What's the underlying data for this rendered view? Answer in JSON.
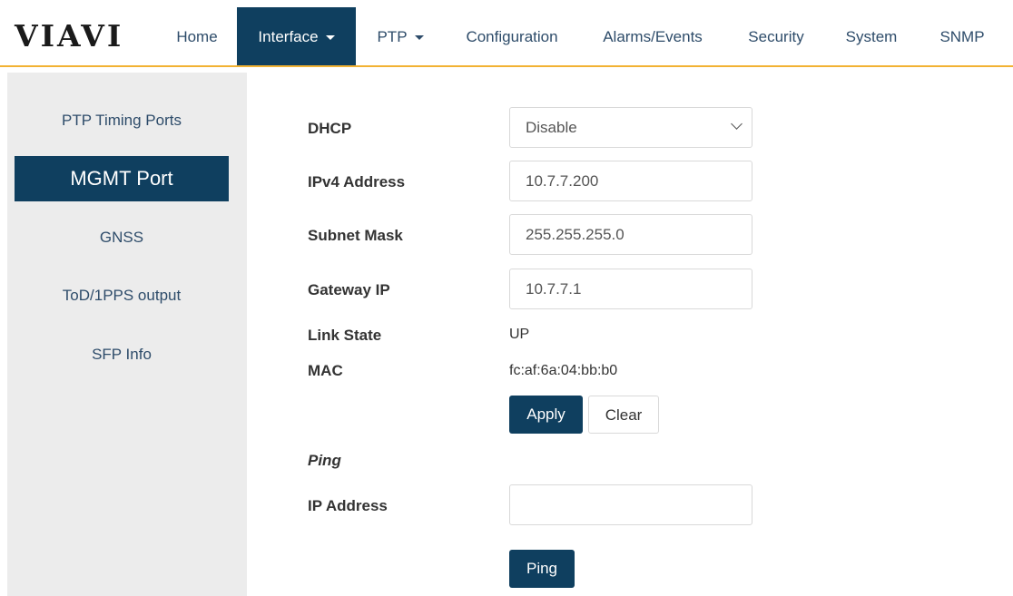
{
  "brand": {
    "logo_text": "VIAVI"
  },
  "nav": {
    "items": [
      {
        "label": "Home",
        "has_caret": false,
        "active": false
      },
      {
        "label": "Interface",
        "has_caret": true,
        "active": true
      },
      {
        "label": "PTP",
        "has_caret": true,
        "active": false
      },
      {
        "label": "Configuration",
        "has_caret": false,
        "active": false
      },
      {
        "label": "Alarms/Events",
        "has_caret": false,
        "active": false
      },
      {
        "label": "Security",
        "has_caret": false,
        "active": false
      },
      {
        "label": "System",
        "has_caret": false,
        "active": false
      },
      {
        "label": "SNMP",
        "has_caret": false,
        "active": false
      }
    ]
  },
  "sidebar": {
    "items": [
      {
        "label": "PTP Timing Ports",
        "active": false
      },
      {
        "label": "MGMT Port",
        "active": true
      },
      {
        "label": "GNSS",
        "active": false
      },
      {
        "label": "ToD/1PPS output",
        "active": false
      },
      {
        "label": "SFP Info",
        "active": false
      }
    ]
  },
  "form": {
    "dhcp": {
      "label": "DHCP",
      "value": "Disable"
    },
    "ipv4": {
      "label": "IPv4 Address",
      "value": "10.7.7.200"
    },
    "subnet": {
      "label": "Subnet Mask",
      "value": "255.255.255.0"
    },
    "gateway": {
      "label": "Gateway IP",
      "value": "10.7.7.1"
    },
    "link_state": {
      "label": "Link State",
      "value": "UP"
    },
    "mac": {
      "label": "MAC",
      "value": "fc:af:6a:04:bb:b0"
    },
    "apply_label": "Apply",
    "clear_label": "Clear"
  },
  "ping": {
    "heading": "Ping",
    "ip": {
      "label": "IP Address",
      "value": ""
    },
    "button_label": "Ping"
  },
  "colors": {
    "primary": "#0f3f5f",
    "accent_line": "#f2b233",
    "sidebar_bg": "#ececec",
    "nav_text": "#2e4c6a"
  }
}
